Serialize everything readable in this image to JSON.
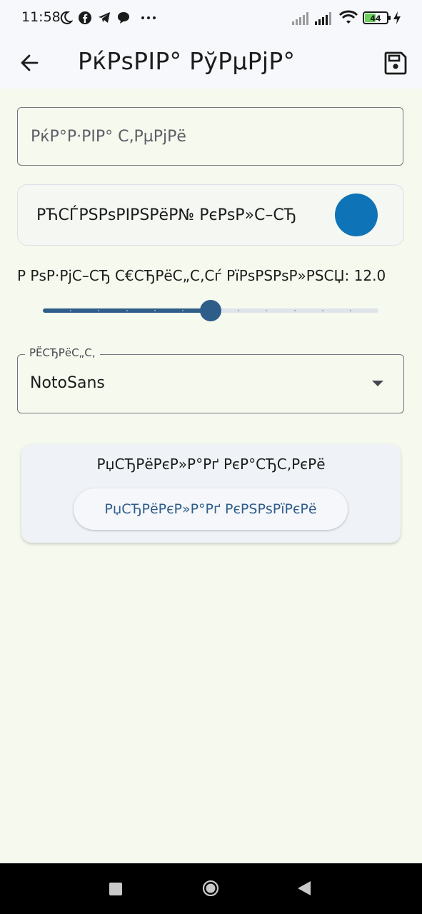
{
  "status_bar": {
    "time": "11:58",
    "battery_level": "44",
    "icons": [
      "moon-icon",
      "facebook-icon",
      "telegram-icon",
      "chat-bubble-icon",
      "more-dots-icon",
      "signal-icon",
      "signal-icon",
      "wifi-icon",
      "battery-icon",
      "charging-icon"
    ]
  },
  "app_bar": {
    "title": "РќРѕРІР° РўРµРјР°",
    "back_icon": "arrow-left-icon",
    "save_icon": "save-floppy-icon"
  },
  "theme_name_field": {
    "placeholder": "РќР°Р·РІР° С‚РµРјРё",
    "value": ""
  },
  "color_picker": {
    "label": "РЋСЃРЅРѕРІРЅРёР№ РєРѕР»С–СЂ",
    "color": "#0f73b7"
  },
  "font_size_slider": {
    "label": "Р РѕР·РјС–СЂ С€СЂРёС„С‚Сѓ РїРѕРЅРѕР»РЅСЏ: 12.0",
    "value": 12.0,
    "min": 6,
    "max": 24,
    "fraction": 0.5,
    "divisions": 12,
    "active_color": "#2f5d8a",
    "inactive_color": "#dfe3ea"
  },
  "font_dropdown": {
    "label": "РЁСЂРёС„С‚",
    "value": "NotoSans"
  },
  "preview": {
    "title": "РџСЂРёРєР»Р°Рґ РєР°СЂС‚РєРё",
    "button_label": "РџСЂРёРєР»Р°Рґ РєРЅРѕРїРєРё"
  }
}
